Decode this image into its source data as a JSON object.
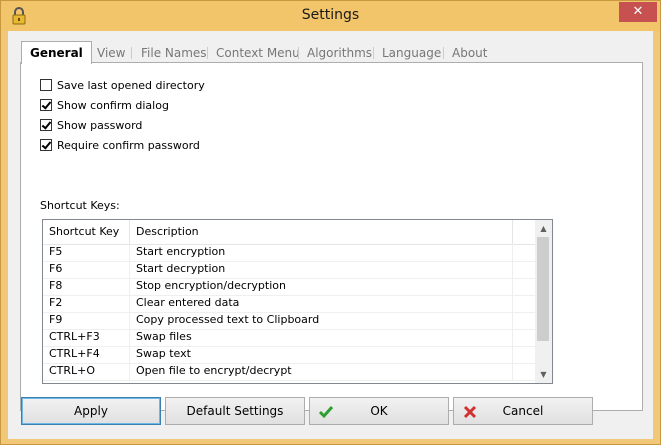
{
  "window": {
    "title": "Settings",
    "close_label": "✕"
  },
  "tabs": [
    "General",
    "View",
    "File Names",
    "Context Menu",
    "Algorithms",
    "Language",
    "About"
  ],
  "options": [
    {
      "label": "Save last opened directory",
      "checked": false
    },
    {
      "label": "Show confirm dialog",
      "checked": true
    },
    {
      "label": "Show password",
      "checked": true
    },
    {
      "label": "Require confirm password",
      "checked": true
    }
  ],
  "shortcuts": {
    "label": "Shortcut Keys:",
    "columns": [
      "Shortcut Key",
      "Description"
    ],
    "rows": [
      [
        "F5",
        "Start encryption"
      ],
      [
        "F6",
        "Start decryption"
      ],
      [
        "F8",
        "Stop encryption/decryption"
      ],
      [
        "F2",
        "Clear entered data"
      ],
      [
        "F9",
        "Copy processed text to Clipboard"
      ],
      [
        "CTRL+F3",
        "Swap files"
      ],
      [
        "CTRL+F4",
        "Swap text"
      ],
      [
        "CTRL+O",
        "Open file to encrypt/decrypt"
      ]
    ]
  },
  "buttons": {
    "apply": "Apply",
    "default_settings": "Default Settings",
    "ok": "OK",
    "cancel": "Cancel"
  },
  "colors": {
    "title_bar": "#f3c56a",
    "close_button": "#c75050",
    "ok_icon": "#2e9e2e",
    "cancel_icon": "#d03030"
  }
}
